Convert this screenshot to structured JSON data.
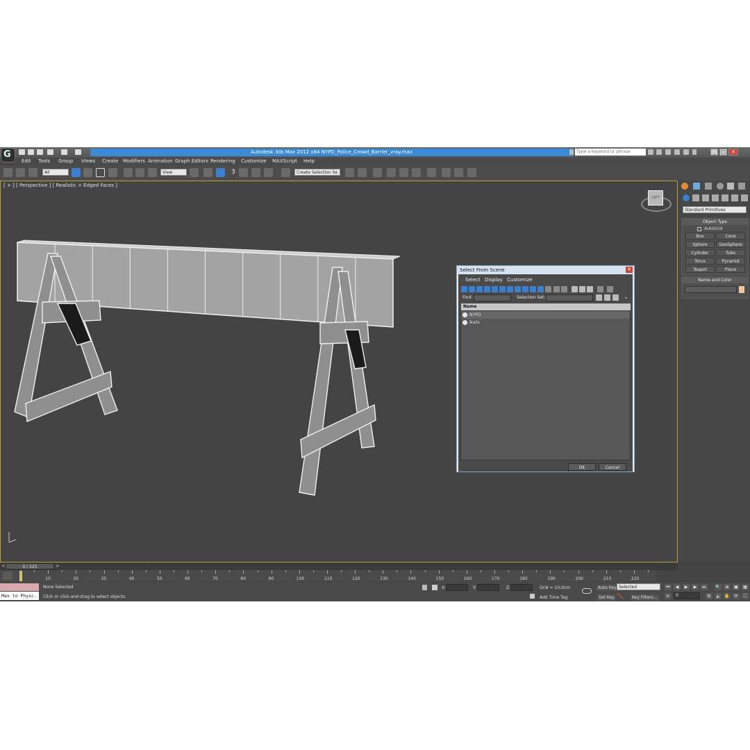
{
  "window": {
    "title": "Autodesk 3ds Max  2012 x64     NYPD_Police_Crowd_Barrier_vray.max",
    "search_placeholder": "Type a keyword or phrase",
    "controls": [
      "_",
      "□",
      "✕"
    ]
  },
  "menu": [
    "Edit",
    "Tools",
    "Group",
    "Views",
    "Create",
    "Modifiers",
    "Animation",
    "Graph Editors",
    "Rendering",
    "Customize",
    "MAXScript",
    "Help"
  ],
  "toolbar": {
    "selection_filter": "All",
    "reference_coord": "View",
    "snap_label": "3",
    "named_selection_placeholder": "Create Selection Se"
  },
  "viewport": {
    "label": "[ + ] [ Perspective ] [ Realistic + Edged Faces ]",
    "viewcube_label": "LEFT",
    "barrier_sign_segments": 10
  },
  "command_panel": {
    "category_dropdown": "Standard Primitives",
    "object_type_header": "Object Type",
    "autogrid_label": "AutoGrid",
    "primitives": [
      "Box",
      "Cone",
      "Sphere",
      "GeoSphere",
      "Cylinder",
      "Tube",
      "Torus",
      "Pyramid",
      "Teapot",
      "Plane"
    ],
    "name_color_header": "Name and Color",
    "object_color": "#f0c8a0"
  },
  "dialog": {
    "title": "Select From Scene",
    "menu": [
      "Select",
      "Display",
      "Customize"
    ],
    "find_label": "Find:",
    "selection_set_label": "Selection Set:",
    "column_header": "Name",
    "items": [
      "NYPD",
      "Nails"
    ],
    "ok_label": "OK",
    "cancel_label": "Cancel"
  },
  "timeline": {
    "frame_display": "0 / 225",
    "ticks": [
      "10",
      "20",
      "30",
      "40",
      "50",
      "60",
      "70",
      "80",
      "90",
      "100",
      "110",
      "120",
      "130",
      "140",
      "150",
      "160",
      "170",
      "180",
      "190",
      "200",
      "210",
      "220"
    ]
  },
  "status": {
    "maxscript_listener": "Max to Physc.",
    "selection": "None Selected",
    "prompt": "Click or click-and-drag to select objects",
    "x_label": "X:",
    "y_label": "Y:",
    "z_label": "Z:",
    "grid": "Grid = 10,0cm",
    "add_time_tag": "Add Time Tag",
    "auto_key": "Auto Key",
    "set_key": "Set Key",
    "key_mode": "Selected",
    "key_filters": "Key Filters...",
    "current_frame": "0"
  }
}
